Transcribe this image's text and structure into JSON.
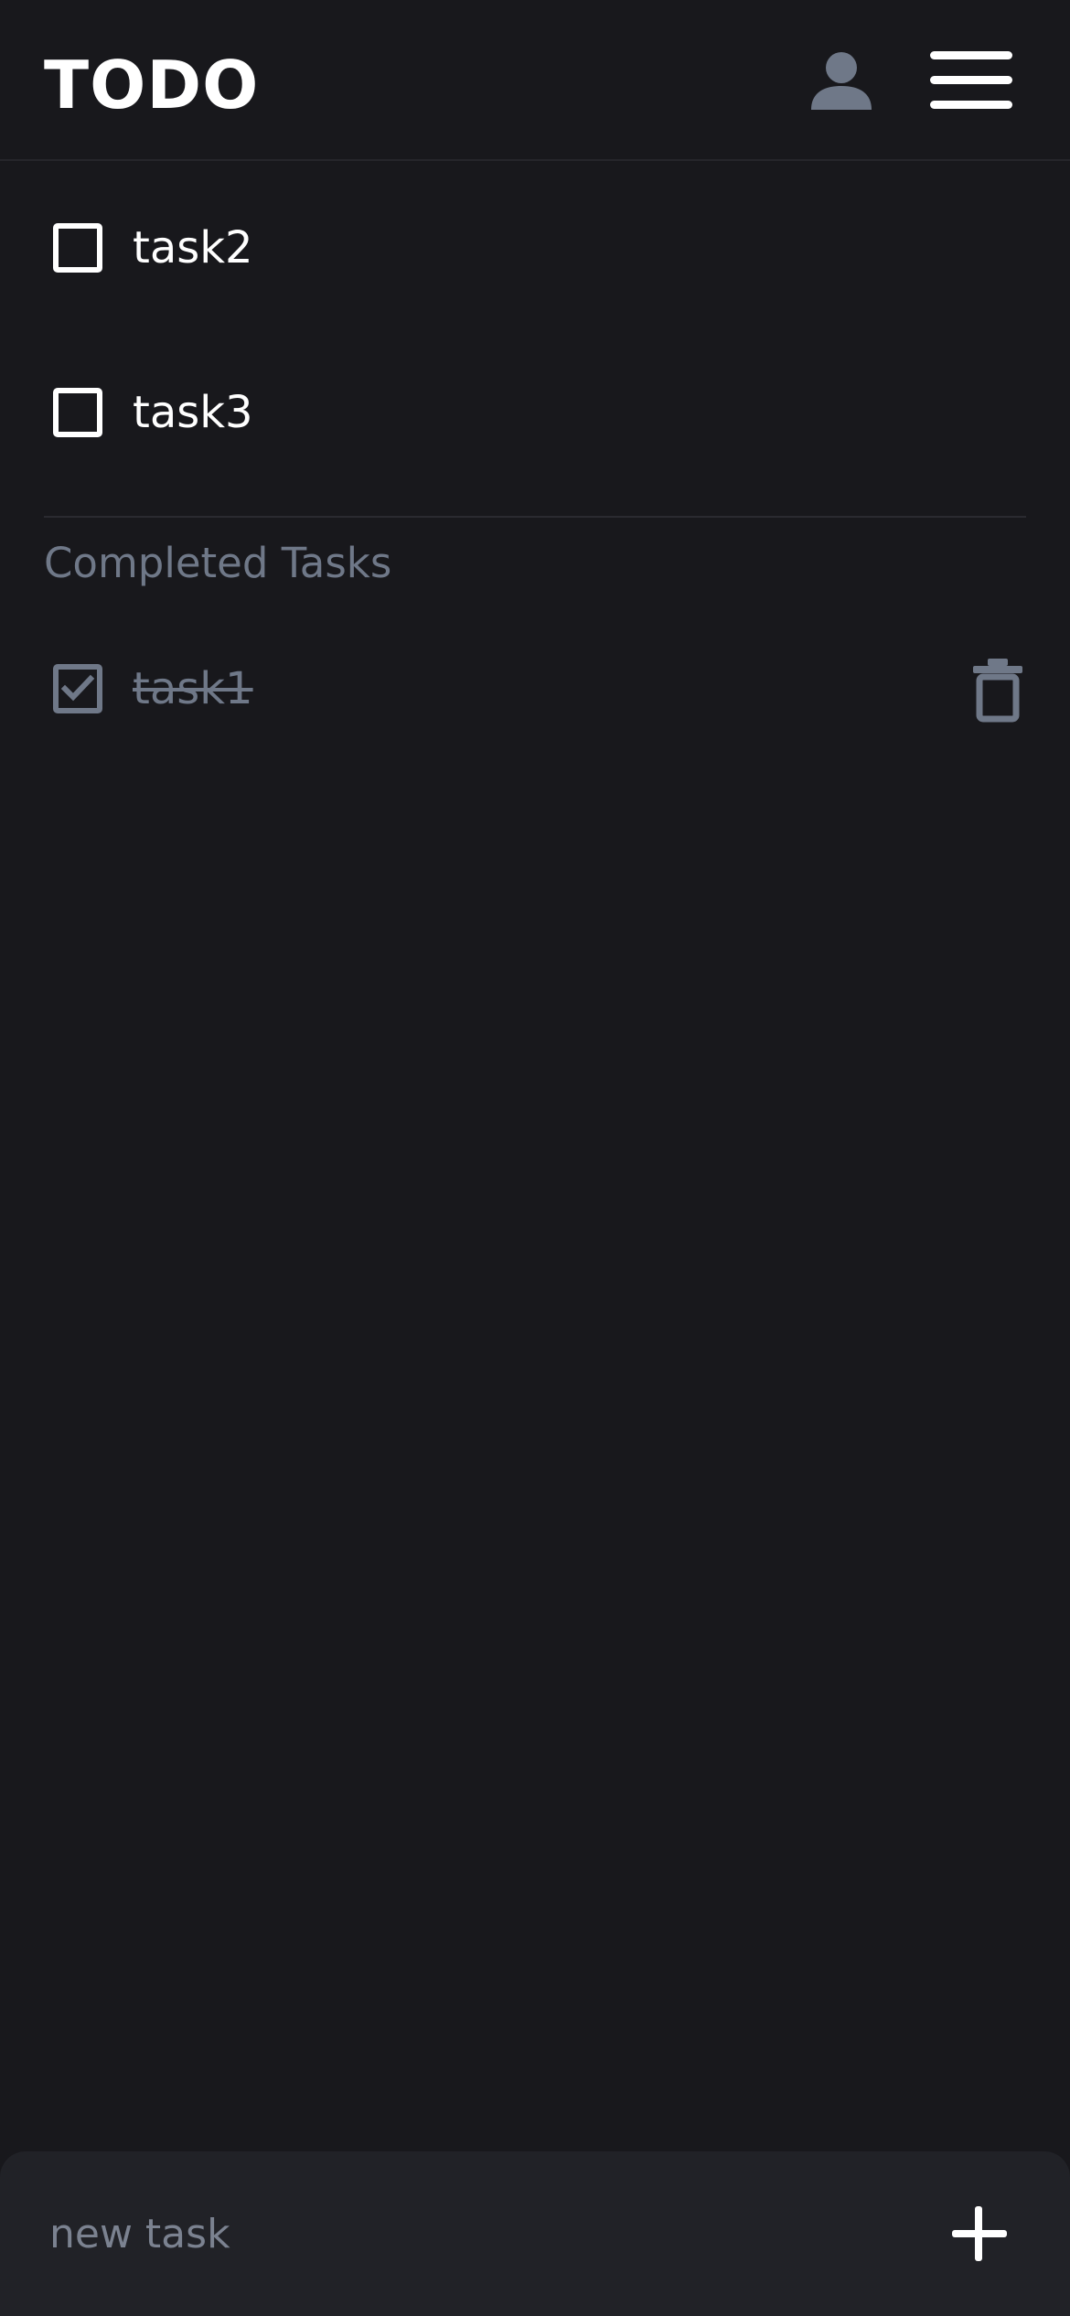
{
  "header": {
    "title": "TODO",
    "profile_icon": "person-icon",
    "menu_icon": "hamburger-menu-icon"
  },
  "tasks": [
    {
      "label": "task2",
      "completed": false
    },
    {
      "label": "task3",
      "completed": false
    }
  ],
  "completed_section": {
    "heading": "Completed Tasks",
    "items": [
      {
        "label": "task1",
        "completed": true,
        "delete_icon": "trash-icon"
      }
    ]
  },
  "input_bar": {
    "value": "",
    "placeholder": "new task",
    "add_icon": "plus-icon"
  },
  "colors": {
    "background": "#18181c",
    "input_bar": "#212227",
    "text": "#ffffff",
    "muted": "#6f7888"
  }
}
